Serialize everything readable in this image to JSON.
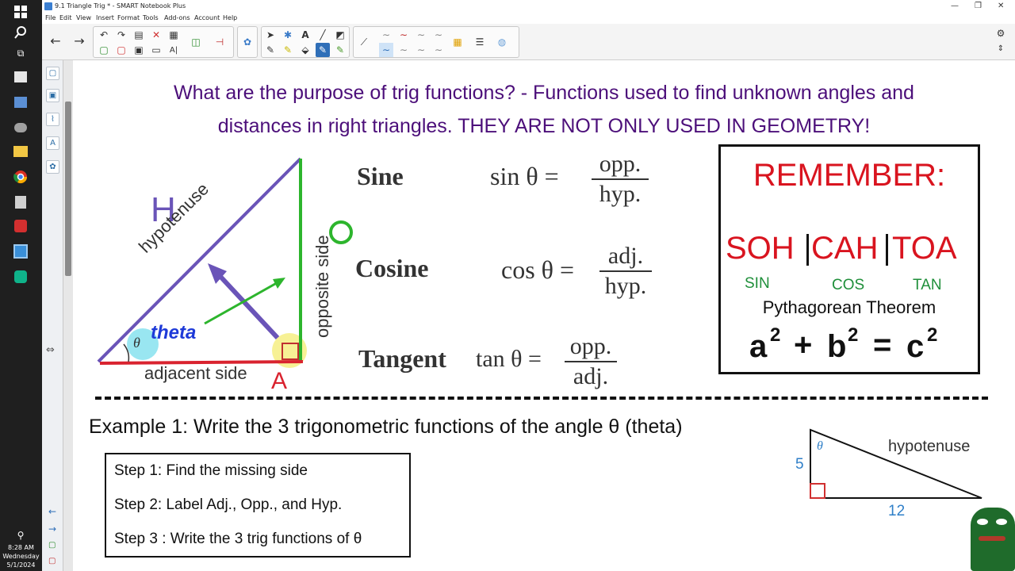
{
  "window": {
    "title": "9.1 Triangle Trig * - SMART Notebook Plus"
  },
  "menu": [
    "File",
    "Edit",
    "View",
    "Insert",
    "Format",
    "Tools",
    "Add-ons",
    "Account",
    "Help"
  ],
  "clock": {
    "time": "8:28 AM",
    "day": "Wednesday",
    "date": "5/1/2024"
  },
  "slide": {
    "heading_line1": "What are the purpose of trig functions? - Functions used to find unknown angles and",
    "heading_line2": "distances in right triangles. THEY ARE NOT ONLY USED IN GEOMETRY!",
    "triangle": {
      "hyp_letter": "H",
      "hyp_label": "hypotenuse",
      "opp_label": "opposite side",
      "opp_letter": "O",
      "adj_label": "adjacent side",
      "adj_letter": "A",
      "theta_word": "theta",
      "theta_symbol": "θ"
    },
    "formulas": [
      {
        "name": "Sine",
        "func": "sin θ =",
        "num": "opp.",
        "den": "hyp."
      },
      {
        "name": "Cosine",
        "func": "cos θ =",
        "num": "adj.",
        "den": "hyp."
      },
      {
        "name": "Tangent",
        "func": "tan θ =",
        "num": "opp.",
        "den": "adj."
      }
    ],
    "remember": {
      "title": "REMEMBER:",
      "soh": "SOH",
      "cah": "CAH",
      "toa": "TOA",
      "sin": "SIN",
      "cos": "COS",
      "tan": "TAN",
      "pythag_label": "Pythagorean Theorem",
      "pythag_a": "a",
      "pythag_b": "b",
      "pythag_c": "c",
      "exp": "2",
      "plus": "+",
      "equals": "="
    },
    "example": {
      "text": "Example 1: Write the 3 trigonometric functions of the angle θ (theta)",
      "steps": [
        "Step 1: Find the missing side",
        "Step 2: Label Adj., Opp., and Hyp.",
        "Step 3 : Write the 3 trig functions of θ"
      ],
      "triangle": {
        "side_vertical": "5",
        "side_horizontal": "12",
        "hyp_label": "hypotenuse",
        "theta": "θ"
      }
    }
  },
  "colors": {
    "heading": "#4c0f7a",
    "hyp": "#6a54b8",
    "opp": "#2db52d",
    "adj": "#d9232f",
    "remember_red": "#d9141f",
    "remember_green": "#1f8f3a"
  }
}
